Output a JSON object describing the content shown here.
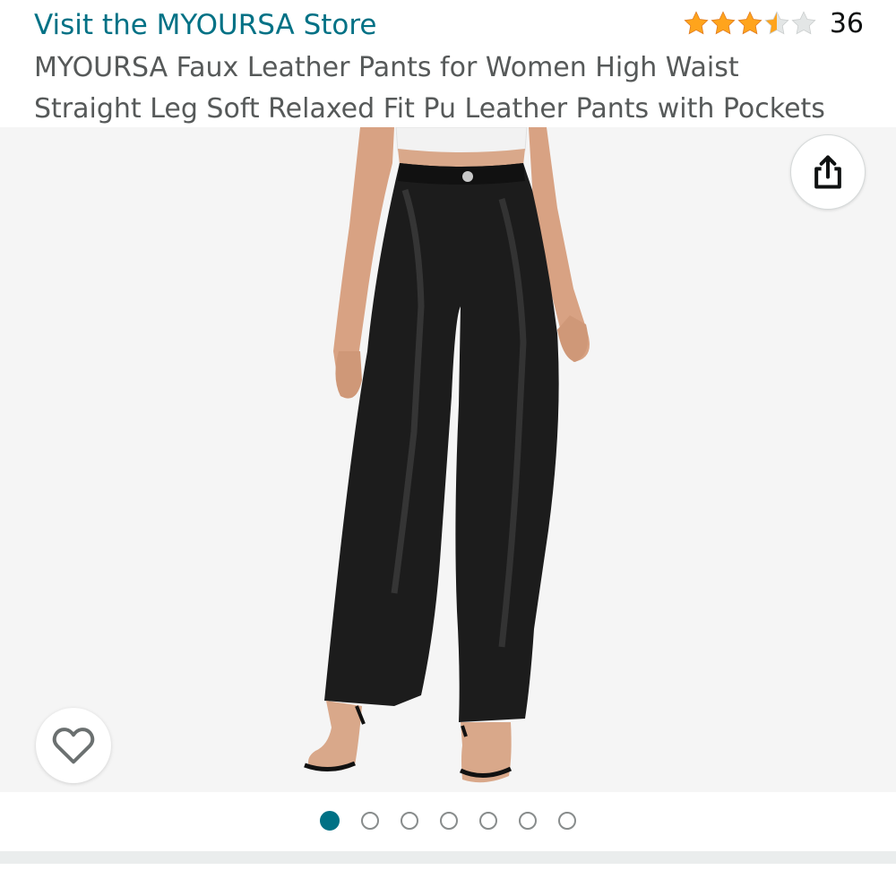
{
  "header": {
    "store_link": "Visit the MYOURSA Store",
    "rating": {
      "stars": 3.5,
      "max_stars": 5,
      "count": "36",
      "star_color": "#ffa41c",
      "empty_star_color": "#d5d9d9"
    }
  },
  "product": {
    "title_line1": "MYOURSA Faux Leather Pants for Women High Waist",
    "title_line2": "Straight Leg Soft Relaxed Fit Pu Leather Pants with Pockets"
  },
  "gallery": {
    "image_icon": "product-photo",
    "share_icon": "share-icon",
    "wishlist_icon": "heart-icon",
    "page_count": 7,
    "active_index": 0
  },
  "colors": {
    "link": "#007185",
    "title": "#565959",
    "dot_active": "#007185"
  }
}
